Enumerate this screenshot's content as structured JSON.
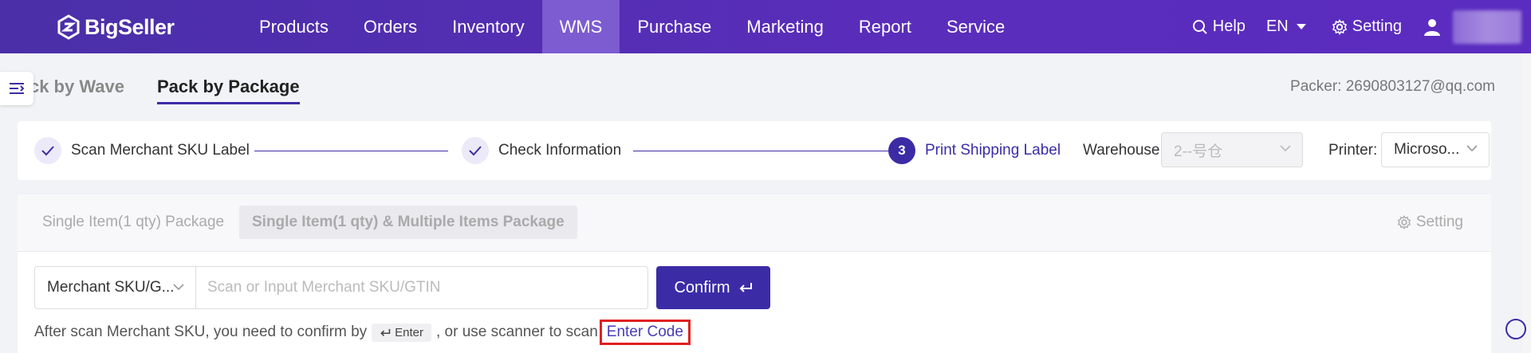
{
  "app": {
    "brand": "BigSeller"
  },
  "nav": {
    "items": [
      {
        "label": "Products"
      },
      {
        "label": "Orders"
      },
      {
        "label": "Inventory"
      },
      {
        "label": "WMS"
      },
      {
        "label": "Purchase"
      },
      {
        "label": "Marketing"
      },
      {
        "label": "Report"
      },
      {
        "label": "Service"
      }
    ],
    "active": "WMS"
  },
  "topright": {
    "help": "Help",
    "lang": "EN",
    "setting": "Setting"
  },
  "subtabs": {
    "wave": "Pack by Wave",
    "package": "Pack by Package"
  },
  "packer": "Packer: 2690803127@qq.com",
  "steps": {
    "s1": "Scan Merchant SKU Label",
    "s2": "Check Information",
    "s3_num": "3",
    "s3": "Print Shipping Label"
  },
  "warehouse": {
    "label": "Warehouse:",
    "value": "2--号仓"
  },
  "printer": {
    "label": "Printer:",
    "value": "Microso..."
  },
  "package_types": {
    "single": "Single Item(1 qty) Package",
    "mixed": "Single Item(1 qty) & Multiple Items Package",
    "setting": "Setting"
  },
  "scan": {
    "type_value": "Merchant SKU/G...",
    "placeholder": "Scan or Input Merchant SKU/GTIN",
    "confirm": "Confirm"
  },
  "hint": {
    "before": "After scan Merchant SKU, you need to confirm by",
    "key": "Enter",
    "after": ", or use scanner to scan",
    "link": "Enter Code"
  },
  "colors": {
    "primary": "#3b2ca6",
    "nav_bg": "#5a2dbb",
    "highlight_border": "#e02020"
  }
}
